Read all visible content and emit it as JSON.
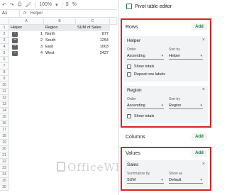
{
  "toolbar": {
    "undo_icon": "undo-icon",
    "redo_icon": "redo-icon",
    "print_icon": "print-icon",
    "paint_icon": "paint-format-icon",
    "zoom": "100%",
    "currency": "$",
    "percent": "%"
  },
  "formula_bar": {
    "cell_ref": "A1",
    "fx": "fx",
    "value": "Helper"
  },
  "sheet": {
    "columns": [
      "A",
      "B",
      "C"
    ],
    "rows": [
      "1",
      "2",
      "3",
      "4",
      "5",
      "6",
      "7",
      "8",
      "9",
      "10",
      "11",
      "12",
      "13",
      "14",
      "15",
      "16",
      "17",
      "18",
      "19",
      "20",
      "21",
      "22",
      "23",
      "24",
      "25",
      "26"
    ],
    "header": [
      "Helper",
      "Region",
      "SUM of Sales"
    ],
    "data": [
      {
        "helper": "1",
        "region": "North",
        "sales": "877"
      },
      {
        "helper": "2",
        "region": "South",
        "sales": "1254"
      },
      {
        "helper": "3",
        "region": "East",
        "sales": "1003"
      },
      {
        "helper": "4",
        "region": "West",
        "sales": "2427"
      }
    ]
  },
  "panel": {
    "title": "Pivot table editor",
    "rows_label": "Rows",
    "add": "Add",
    "helper_card": {
      "title": "Helper",
      "order_label": "Order",
      "order_value": "Ascending",
      "sortby_label": "Sort by",
      "sortby_value": "Helper",
      "show_totals": "Show totals",
      "repeat_labels": "Repeat row labels"
    },
    "region_card": {
      "title": "Region",
      "order_label": "Order",
      "order_value": "Ascending",
      "sortby_label": "Sort by",
      "sortby_value": "Region",
      "show_totals": "Show totals"
    },
    "columns_label": "Columns",
    "values_label": "Values",
    "sales_card": {
      "title": "Sales",
      "summarize_label": "Summarize by",
      "summarize_value": "SUM",
      "showas_label": "Show as",
      "showas_value": "Default"
    }
  },
  "watermark": "OfficeWheel",
  "colors": {
    "accent": "#188038",
    "highlight": "#e02020"
  }
}
